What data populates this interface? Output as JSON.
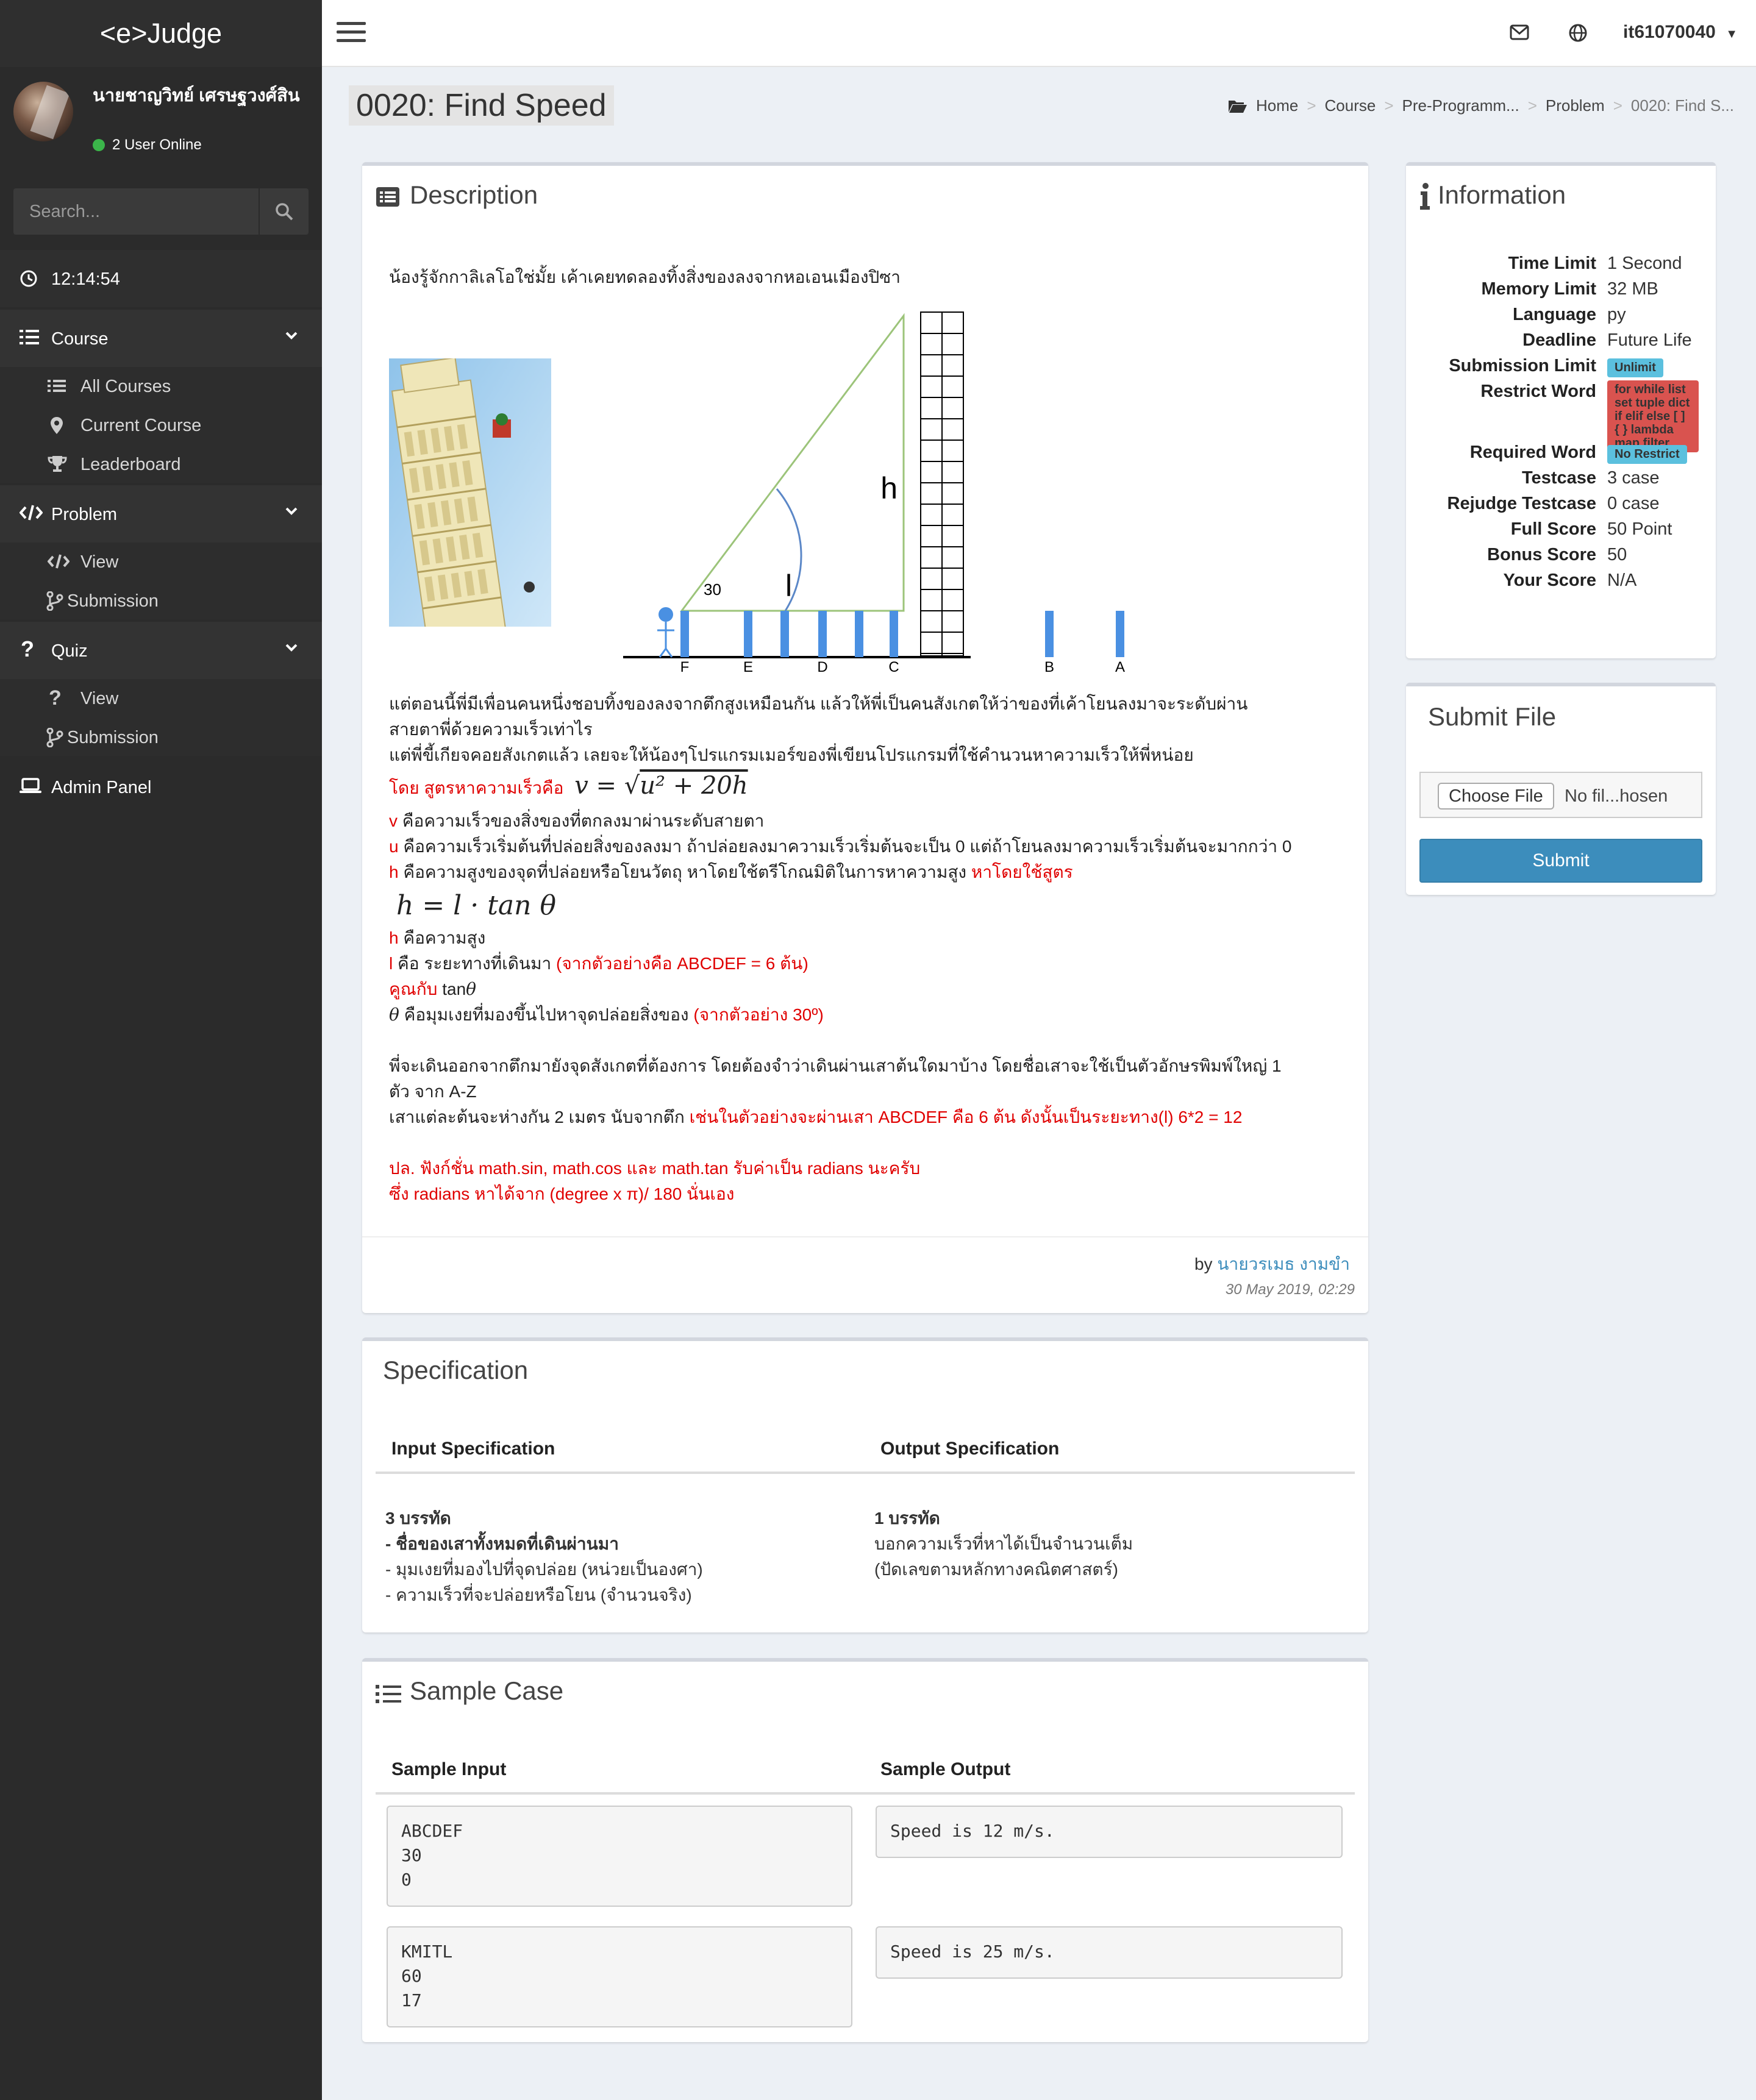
{
  "app": {
    "logo": "<e>Judge"
  },
  "user": {
    "name": "นายชาญวิทย์ เศรษฐวงศ์สิน",
    "online": "2 User Online",
    "topbar_user": "it61070040"
  },
  "search": {
    "placeholder": "Search..."
  },
  "clock": "12:14:54",
  "nav": {
    "course": {
      "label": "Course",
      "items": [
        "All Courses",
        "Current Course",
        "Leaderboard"
      ]
    },
    "problem": {
      "label": "Problem",
      "items": [
        "View",
        "Submission"
      ]
    },
    "quiz": {
      "label": "Quiz",
      "items": [
        "View",
        "Submission"
      ]
    },
    "admin": "Admin Panel"
  },
  "page": {
    "title": "0020: Find Speed"
  },
  "breadcrumb": [
    "Home",
    "Course",
    "Pre-Programm...",
    "Problem",
    "0020: Find S..."
  ],
  "description": {
    "title": "Description",
    "intro": "น้องรู้จักกาลิเลโอใช่มั้ย เค้าเคยทดลองทิ้งสิ่งของลงจากหอเอนเมืองปิซา",
    "diagram": {
      "angle": "30",
      "h": "h",
      "l": "l",
      "posts": [
        "F",
        "E",
        "D",
        "C",
        "B",
        "A"
      ]
    },
    "p1": "แต่ตอนนี้พี่มีเพื่อนคนหนึ่งชอบทิ้งของลงจากตึกสูงเหมือนกัน แล้วให้พี่เป็นคนสังเกตให้ว่าของที่เค้าโยนลงมาจะระดับผ่าน",
    "p2": "สายตาพี่ด้วยความเร็วเท่าไร",
    "p3": "แต่พี่ขี้เกียจคอยสังเกตแล้ว เลยจะให้น้องๆโปรแกรมเมอร์ของพี่เขียนโปรแกรมที่ใช้คำนวนหาความเร็วให้พี่หน่อย",
    "formula_label": "โดย สูตรหาความเร็วคือ",
    "v_label": "v",
    "v_text": "คือความเร็วของสิ่งของที่ตกลงมาผ่านระดับสายตา",
    "u_label": "u",
    "u_text": "คือความเร็วเริ่มต้นที่ปล่อยสิ่งของลงมา ถ้าปล่อยลงมาความเร็วเริ่มต้นจะเป็น 0  แต่ถ้าโยนลงมาความเร็วเริ่มต้นจะมากกว่า 0",
    "h_label": "h",
    "h_text": "คือความสูงของจุดที่ปล่อยหรือโยนวัตถุ หาโดยใช้ตรีโกณมิติในการหาความสูง ",
    "h_red": "หาโดยใช้สูตร",
    "h2_label": "h",
    "h2_text": "คือความสูง",
    "l_label": "l",
    "l_text": "คือ ระยะทางที่เดินมา ",
    "l_red": "(จากตัวอย่างคือ ABCDEF = 6 ต้น)",
    "mul_red": "คูณกับ",
    "mul_text": " tan",
    "theta_text": "คือมุมเงยที่มองขึ้นไปหาจุดปล่อยสิ่งของ ",
    "theta_red": "(จากตัวอย่าง 30º)",
    "p4": "พี่จะเดินออกจากตึกมายังจุดสังเกตที่ต้องการ โดยต้องจำว่าเดินผ่านเสาต้นใดมาบ้าง โดยชื่อเสาจะใช้เป็นตัวอักษรพิมพ์ใหญ่ 1",
    "p5": "ตัว จาก A-Z",
    "p6": "เสาแต่ละต้นจะห่างกัน 2 เมตร นับจากตึก ",
    "p6_red": "เช่นในตัวอย่างจะผ่านเสา ABCDEF คือ 6 ต้น ดังนั้นเป็นระยะทาง(l) 6*2 = 12",
    "ps1": "ปล. ฟังก์ชั่น math.sin, math.cos และ math.tan รับค่าเป็น radians นะครับ",
    "ps2": "ซึ่ง radians หาได้จาก (degree x π)/ 180 นั่นเอง",
    "by": "by",
    "author": "นายวรเมธ งามขำ",
    "date": "30 May 2019, 02:29"
  },
  "info": {
    "title": "Information",
    "rows": [
      {
        "k": "Time Limit",
        "v": "1 Second"
      },
      {
        "k": "Memory Limit",
        "v": "32 MB"
      },
      {
        "k": "Language",
        "v": "py"
      },
      {
        "k": "Deadline",
        "v": "Future Life"
      },
      {
        "k": "Submission Limit",
        "v": "Unlimit"
      },
      {
        "k": "Restrict Word",
        "v": "for while list set tuple dict if elif else [ ] { } lambda map filter"
      },
      {
        "k": "Required Word",
        "v": "No Restrict"
      },
      {
        "k": "Testcase",
        "v": "3 case"
      },
      {
        "k": "Rejudge Testcase",
        "v": "0 case"
      },
      {
        "k": "Full Score",
        "v": "50 Point"
      },
      {
        "k": "Bonus Score",
        "v": "50"
      },
      {
        "k": "Your Score",
        "v": "N/A"
      }
    ],
    "colors": {
      "info": "#5bc0de",
      "danger": "#d9534f"
    }
  },
  "submit": {
    "title": "Submit File",
    "choose": "Choose File",
    "nofile": "No fil...hosen",
    "button": "Submit"
  },
  "spec": {
    "title": "Specification",
    "input_h": "Input Specification",
    "output_h": "Output Specification",
    "input": [
      "3 บรรทัด",
      "- ชื่อของเสาทั้งหมดที่เดินผ่านมา",
      "- มุมเงยที่มองไปที่จุดปล่อย (หน่วยเป็นองศา)",
      "- ความเร็วที่จะปล่อยหรือโยน (จำนวนจริง)"
    ],
    "output": [
      "1 บรรทัด",
      "บอกความเร็วที่หาได้เป็นจำนวนเต็ม",
      "(ปัดเลขตามหลักทางคณิตศาสตร์)"
    ]
  },
  "sample": {
    "title": "Sample Case",
    "input_h": "Sample Input",
    "output_h": "Sample Output",
    "cases": [
      {
        "input": "ABCDEF\n30\n0",
        "output": "Speed is 12 m/s."
      },
      {
        "input": "KMITL\n60\n17",
        "output": "Speed is 25 m/s."
      }
    ]
  }
}
